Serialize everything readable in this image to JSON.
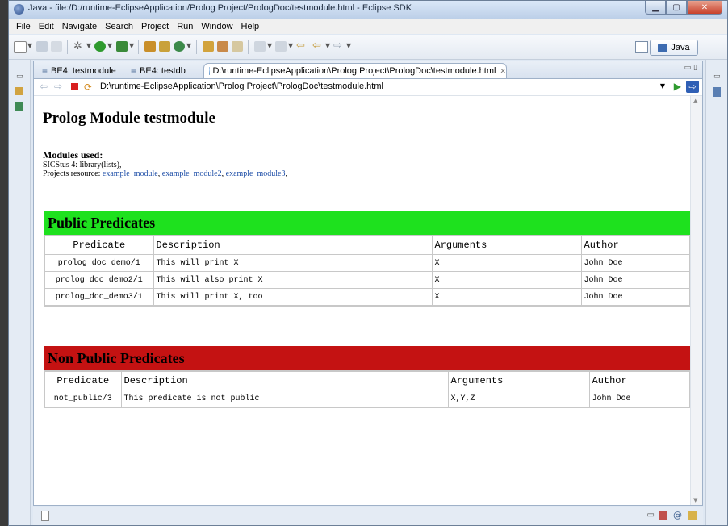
{
  "window": {
    "title": "Java - file:/D:/runtime-EclipseApplication/Prolog Project/PrologDoc/testmodule.html - Eclipse SDK"
  },
  "menu": [
    "File",
    "Edit",
    "Navigate",
    "Search",
    "Project",
    "Run",
    "Window",
    "Help"
  ],
  "perspective": {
    "label": "Java"
  },
  "tabs": [
    {
      "label": "BE4: testmodule"
    },
    {
      "label": "BE4: testdb"
    },
    {
      "label": "D:\\runtime-EclipseApplication\\Prolog Project\\PrologDoc\\testmodule.html",
      "close": "✕"
    }
  ],
  "address": {
    "url": "D:\\runtime-EclipseApplication\\Prolog Project\\PrologDoc\\testmodule.html"
  },
  "page": {
    "title": "Prolog Module testmodule",
    "modules_label": "Modules used:",
    "sicstus_line": "SICStus 4: library(lists),",
    "projects_prefix": "Projects resource:",
    "project_links": [
      "example_module",
      "example_module2",
      "example_module3"
    ]
  },
  "public": {
    "heading": "Public Predicates",
    "color": "#1ee11e",
    "columns": [
      "Predicate",
      "Description",
      "Arguments",
      "Author"
    ],
    "rows": [
      [
        "prolog_doc_demo/1",
        "This will print X",
        "X",
        "John Doe"
      ],
      [
        "prolog_doc_demo2/1",
        "This will also print X",
        "X",
        "John Doe"
      ],
      [
        "prolog_doc_demo3/1",
        "This will print X, too",
        "X",
        "John Doe"
      ]
    ]
  },
  "nonpublic": {
    "heading": "Non Public Predicates",
    "color": "#c41212",
    "columns": [
      "Predicate",
      "Description",
      "Arguments",
      "Author"
    ],
    "rows": [
      [
        "not_public/3",
        "This predicate is not public",
        "X,Y,Z",
        "John Doe"
      ]
    ]
  }
}
